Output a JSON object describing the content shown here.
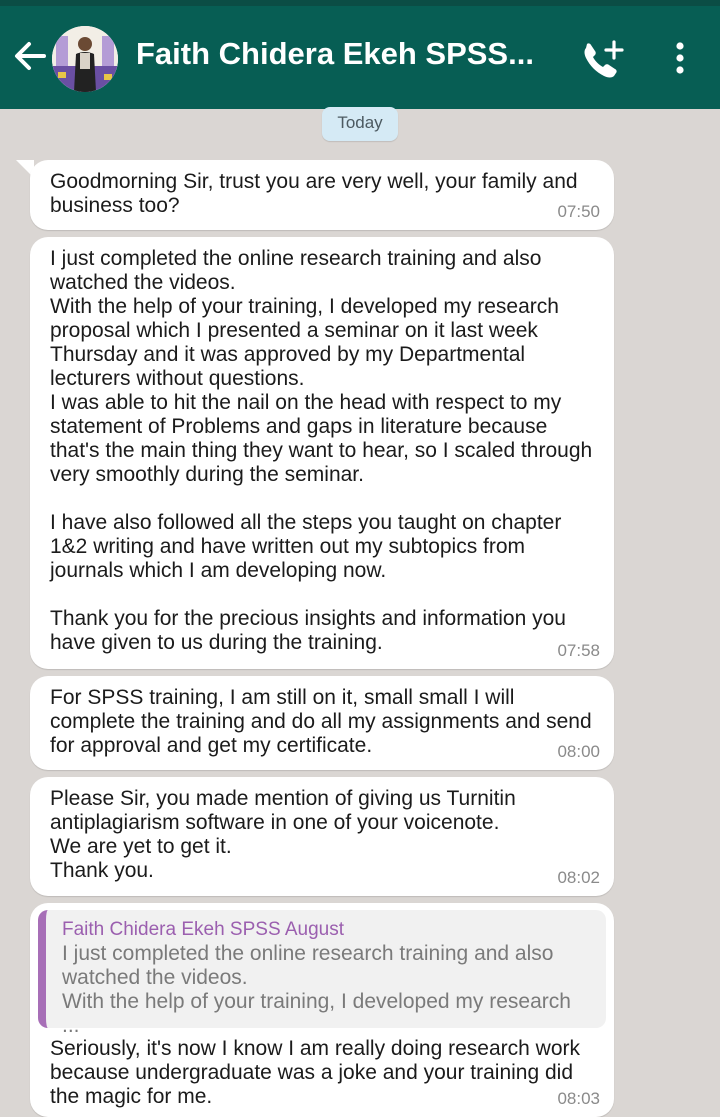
{
  "header": {
    "title": "Faith Chidera Ekeh SPSS...",
    "back_icon": "arrow-left-icon",
    "call_icon": "add-call-icon",
    "menu_icon": "more-vertical-icon",
    "header_color": "#075e54"
  },
  "date_chip": "Today",
  "messages": [
    {
      "text": "Goodmorning Sir, trust you are very well, your family and business too?",
      "time": "07:50"
    },
    {
      "text": "I just completed the online research training and also watched the videos.\nWith the help of your training, I developed my research proposal which I presented a seminar on it last week Thursday and it was approved by my Departmental lecturers without questions.\nI was able to hit the nail on the head with respect to my statement of Problems and gaps in literature because that's the main thing they want to hear, so I scaled through very smoothly during the seminar.\n\nI have also followed all the steps you taught on chapter 1&2 writing and have written out my subtopics from journals which I am developing now.\n\nThank you for the precious insights and information you have given to us during the training.",
      "time": "07:58"
    },
    {
      "text": "For SPSS training, I am still on it, small small I will complete the training and do all my assignments and send for approval and get my certificate.",
      "time": "08:00"
    },
    {
      "text": "Please Sir, you made mention of giving us Turnitin antiplagiarism software in one of your voicenote.\nWe are yet to get it.\nThank you.",
      "time": "08:02"
    },
    {
      "quote": {
        "name": "Faith Chidera Ekeh SPSS August",
        "text": "I just completed the online research training and also watched the videos.\nWith the help of your training, I developed my research ..."
      },
      "text": "Seriously, it's now I know I am really doing research work because undergraduate was a joke and your training did the magic for me.",
      "time": "08:03"
    }
  ]
}
